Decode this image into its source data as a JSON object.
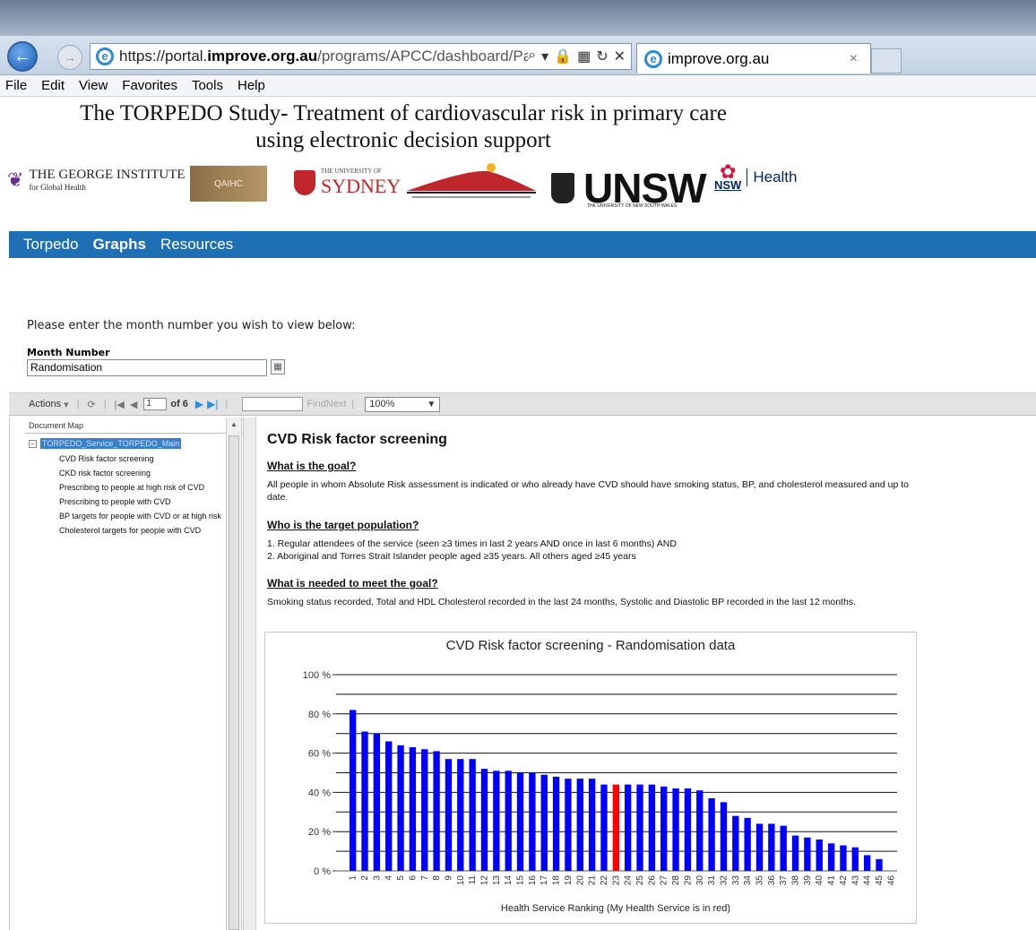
{
  "browser": {
    "url_prefix": "https://portal.",
    "url_domain": "improve.org.au",
    "url_rest": "/programs/APCC/dashboard/Page",
    "tab_title": "improve.org.au",
    "menu": [
      "File",
      "Edit",
      "View",
      "Favorites",
      "Tools",
      "Help"
    ]
  },
  "site": {
    "title_line1": "The TORPEDO Study- Treatment of cardiovascular risk in primary care",
    "title_line2": "using electronic decision support",
    "logos": {
      "george": "THE GEORGE INSTITUTE",
      "george_sub": "for Global Health",
      "qaihc": "QAIHC",
      "sydney_sub": "THE UNIVERSITY OF",
      "sydney": "SYDNEY",
      "unsw": "UNSW",
      "unsw_sub": "THE UNIVERSITY OF NEW SOUTH WALES",
      "nsw": "NSW",
      "nsw_health": "Health"
    },
    "nav": [
      "Torpedo",
      "Graphs",
      "Resources"
    ],
    "nav_active": "Graphs"
  },
  "params": {
    "prompt": "Please enter the month number you wish to view below:",
    "label": "Month Number",
    "value": "Randomisation"
  },
  "toolbar": {
    "actions": "Actions",
    "page": "1",
    "of": "of 6",
    "findnext": "FindNext",
    "zoom": "100%"
  },
  "docmap": {
    "header": "Document Map",
    "root": "TORPEDO_Service_TORPEDO_Main",
    "items": [
      "CVD Risk factor screening",
      "CKD risk factor screening",
      "Prescribing to people at high risk of CVD",
      "Prescribing to people with CVD",
      "BP targets for people with CVD or at high risk",
      "Cholesterol targets for people with CVD"
    ]
  },
  "report": {
    "title": "CVD Risk factor screening",
    "goal_heading": "What is the goal?",
    "goal_text": "All people in whom Absolute Risk assessment is indicated or who already have CVD should have smoking status, BP, and cholesterol measured and up to date.",
    "pop_heading": "Who is the target population?",
    "pop_line1": "1. Regular attendees of the service (seen ≥3 times in last 2 years AND once in last 6 months) AND",
    "pop_line2": "2. Aboriginal and Torres Strait Islander people aged ≥35 years. All others aged ≥45 years",
    "need_heading": "What is needed to meet the goal?",
    "need_text": "Smoking status recorded, Total and HDL Cholesterol recorded in the last 24 months, Systolic and Diastolic BP recorded in the last 12 months."
  },
  "colors": {
    "nav_bg": "#1f6fb5",
    "bar": "#0000ff",
    "bar_highlight": "#ff0000"
  },
  "chart_data": {
    "type": "bar",
    "title": "CVD Risk factor screening - Randomisation data",
    "xlabel": "Health Service Ranking (My Health Service is in red)",
    "ylabel": "",
    "ylim": [
      0,
      100
    ],
    "yticks": [
      "0 %",
      "20 %",
      "40 %",
      "60 %",
      "80 %",
      "100 %"
    ],
    "grid": true,
    "highlight_category": "23",
    "categories": [
      "1",
      "2",
      "3",
      "4",
      "5",
      "6",
      "7",
      "8",
      "9",
      "10",
      "11",
      "12",
      "13",
      "14",
      "15",
      "16",
      "17",
      "18",
      "19",
      "20",
      "21",
      "22",
      "23",
      "24",
      "25",
      "26",
      "27",
      "28",
      "29",
      "30",
      "31",
      "32",
      "33",
      "34",
      "35",
      "36",
      "37",
      "38",
      "39",
      "40",
      "41",
      "42",
      "43",
      "44",
      "45",
      "46"
    ],
    "values": [
      82,
      71,
      70,
      66,
      64,
      63,
      62,
      61,
      57,
      57,
      57,
      52,
      51,
      51,
      50,
      50,
      49,
      48,
      47,
      47,
      47,
      44,
      44,
      44,
      44,
      44,
      43,
      42,
      42,
      41,
      37,
      35,
      28,
      27,
      24,
      24,
      23,
      18,
      17,
      16,
      14,
      13,
      12,
      8,
      6,
      0
    ]
  }
}
